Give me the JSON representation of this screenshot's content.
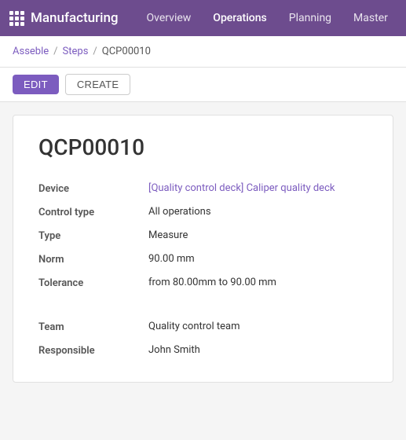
{
  "navbar": {
    "logo_text": "Manufacturing",
    "links": [
      {
        "label": "Overview",
        "active": false
      },
      {
        "label": "Operations",
        "active": true
      },
      {
        "label": "Planning",
        "active": false
      },
      {
        "label": "Master",
        "active": false
      }
    ]
  },
  "breadcrumb": {
    "parent1": "Asseble",
    "separator1": "/",
    "parent2": "Steps",
    "separator2": "/",
    "current": "QCP00010"
  },
  "actions": {
    "edit_label": "EDIT",
    "create_label": "CREATE"
  },
  "record": {
    "title": "QCP00010",
    "fields": [
      {
        "label": "Device",
        "value": "[Quality control deck] Caliper quality deck",
        "is_link": true
      },
      {
        "label": "Control type",
        "value": "All operations",
        "is_link": false
      },
      {
        "label": "Type",
        "value": "Measure",
        "is_link": false
      },
      {
        "label": "Norm",
        "value": "90.00 mm",
        "is_link": false
      },
      {
        "label": "Tolerance",
        "value": "from 80.00mm to 90.00 mm",
        "is_link": false
      }
    ],
    "fields2": [
      {
        "label": "Team",
        "value": "Quality control team",
        "is_link": false
      },
      {
        "label": "Responsible",
        "value": "John Smith",
        "is_link": false
      }
    ]
  }
}
